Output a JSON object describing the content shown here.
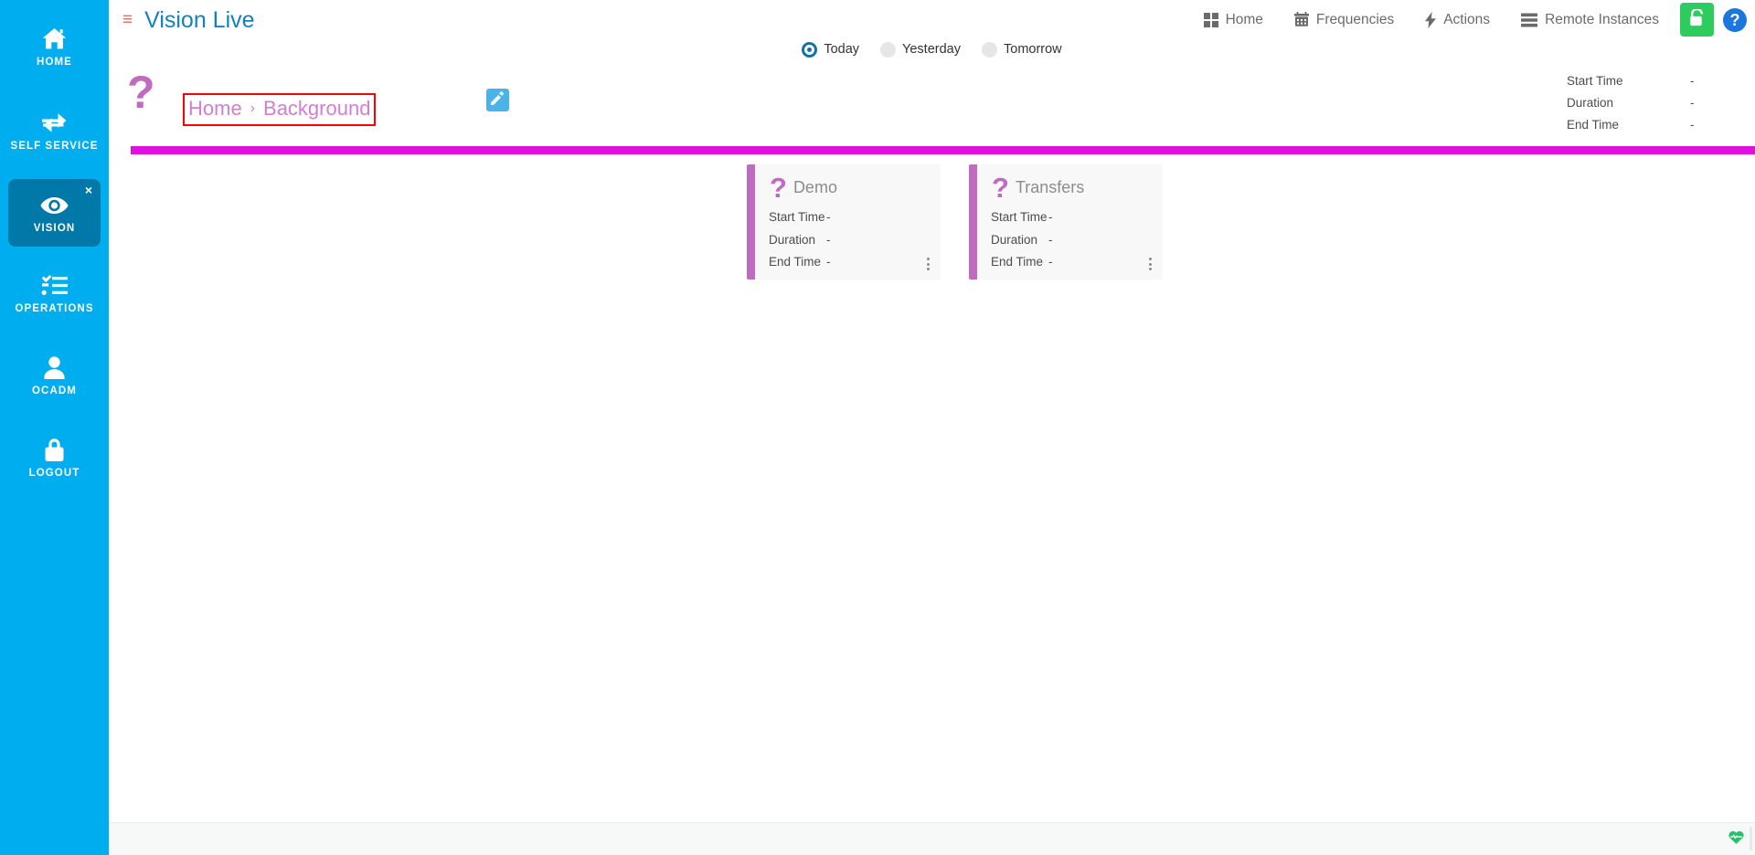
{
  "colors": {
    "sidebar_bg": "#00AEEF",
    "sidebar_active_bg": "#0079A8",
    "brand_blue": "#1580BD",
    "hamburger_red": "#F5655B",
    "orchid": "#C06BC0",
    "breadcrumb_link": "#D27ED2",
    "highlight_red": "#FF0000",
    "divider_magenta": "#E010E0",
    "unlock_green": "#2ECC5D",
    "help_blue": "#1B76DE",
    "edit_blue": "#4BB3E8",
    "radio_selected": "#1172A8",
    "status_green": "#25C16B",
    "footer_bg": "#F7F8F8",
    "card_bg": "#F8F8F8"
  },
  "sidebar": {
    "items": [
      {
        "label": "HOME",
        "icon": "home-icon",
        "active": false
      },
      {
        "label": "SELF SERVICE",
        "icon": "exchange-arrows-icon",
        "active": false
      },
      {
        "label": "VISION",
        "icon": "eye-icon",
        "active": true,
        "close_glyph": "×"
      },
      {
        "label": "OPERATIONS",
        "icon": "checklist-icon",
        "active": false
      },
      {
        "label": "OCADM",
        "icon": "user-icon",
        "active": false
      },
      {
        "label": "LOGOUT",
        "icon": "lock-icon",
        "active": false
      }
    ]
  },
  "topbar": {
    "menu_icon": "hamburger-menu-icon",
    "menu_glyph": "≡",
    "title": "Vision Live",
    "nav": [
      {
        "label": "Home",
        "icon": "grid-icon"
      },
      {
        "label": "Frequencies",
        "icon": "calendar-icon"
      },
      {
        "label": "Actions",
        "icon": "lightning-bolt-icon"
      },
      {
        "label": "Remote Instances",
        "icon": "server-icon"
      }
    ],
    "unlock_button": {
      "icon": "unlock-icon",
      "label": ""
    },
    "help_button": {
      "icon": "question-circle-icon",
      "glyph": "?"
    }
  },
  "day_selector": {
    "options": [
      {
        "label": "Today",
        "selected": true
      },
      {
        "label": "Yesterday",
        "selected": false
      },
      {
        "label": "Tomorrow",
        "selected": false
      }
    ]
  },
  "breadcrumb": {
    "status_icon": "question-mark-icon",
    "status_glyph": "?",
    "items": [
      {
        "label": "Home"
      },
      {
        "label": "Background"
      }
    ],
    "separator": "›",
    "edit_button": {
      "icon": "pencil-edit-icon"
    }
  },
  "header_meta": {
    "rows": [
      {
        "key": "Start Time",
        "value": "-"
      },
      {
        "key": "Duration",
        "value": "-"
      },
      {
        "key": "End Time",
        "value": "-"
      }
    ]
  },
  "cards": [
    {
      "title": "Demo",
      "status_icon": "question-mark-icon",
      "status_glyph": "?",
      "rows": [
        {
          "key": "Start Time",
          "value": "-"
        },
        {
          "key": "Duration",
          "value": "-"
        },
        {
          "key": "End Time",
          "value": "-"
        }
      ],
      "menu_icon": "vertical-dots-menu-icon"
    },
    {
      "title": "Transfers",
      "status_icon": "question-mark-icon",
      "status_glyph": "?",
      "rows": [
        {
          "key": "Start Time",
          "value": "-"
        },
        {
          "key": "Duration",
          "value": "-"
        },
        {
          "key": "End Time",
          "value": "-"
        }
      ],
      "menu_icon": "vertical-dots-menu-icon"
    }
  ],
  "footer": {
    "status_icon": "heartbeat-health-icon"
  }
}
